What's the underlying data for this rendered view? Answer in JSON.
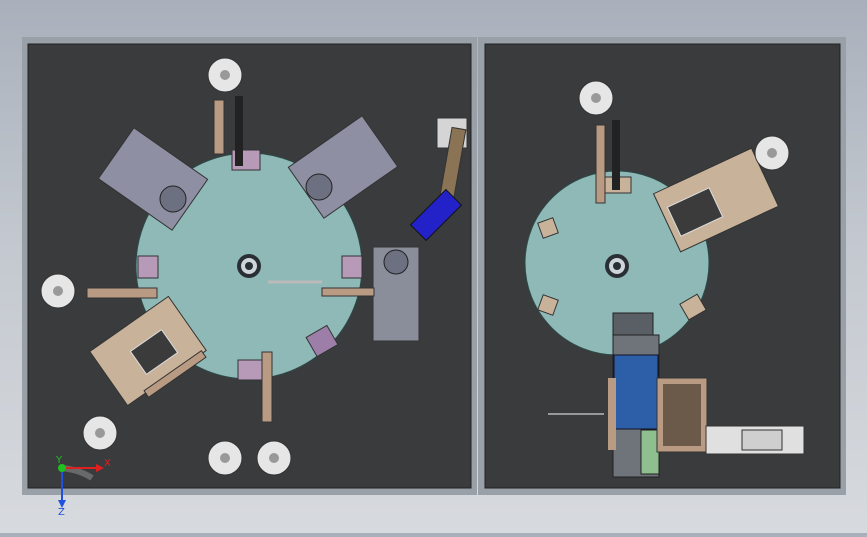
{
  "viewport": {
    "background_gradient": [
      "#a9b0bb",
      "#d7dade"
    ],
    "frame_color": "#9aa0a8",
    "plate_color": "#3a3b3d",
    "turntable_color": "#8fb9b6"
  },
  "triad": {
    "x_label": "X",
    "y_label": "Y",
    "z_label": "Z",
    "x_color": "#e02020",
    "y_color": "#20c020",
    "z_color": "#2050e0"
  }
}
